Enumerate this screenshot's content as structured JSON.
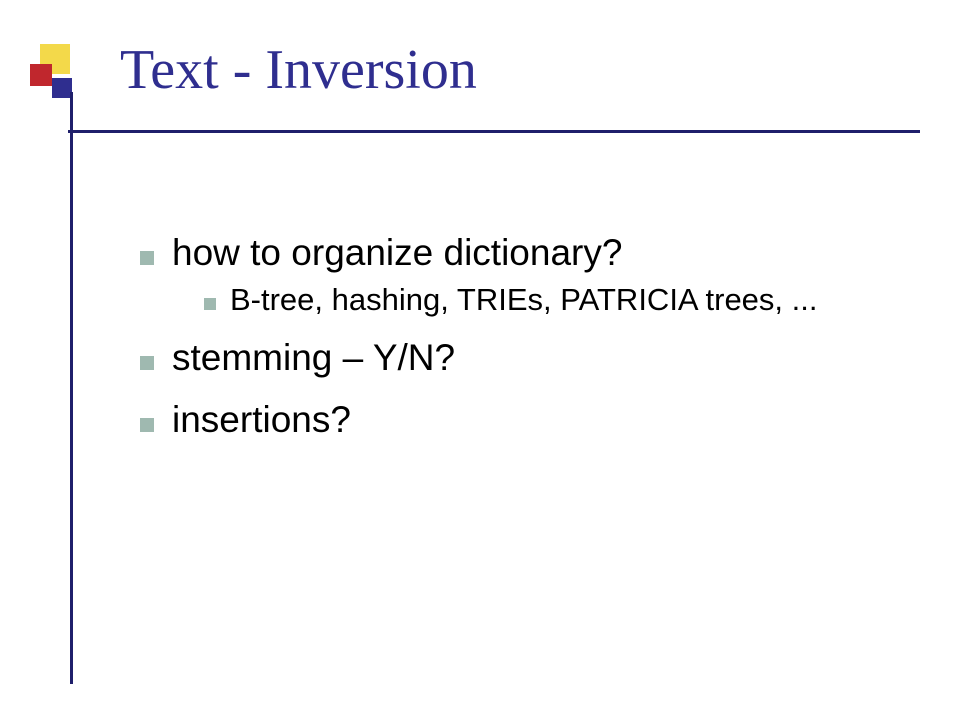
{
  "title": "Text - Inversion",
  "bullets": [
    {
      "text": "how to organize dictionary?",
      "children": [
        {
          "text": "B-tree, hashing, TRIEs, PATRICIA trees, ..."
        }
      ]
    },
    {
      "text": "stemming – Y/N?"
    },
    {
      "text": "insertions?"
    }
  ],
  "colors": {
    "title": "#2f2e8f",
    "rule": "#1f1f6b",
    "bullet": "#9fb9b0",
    "accentYellow": "#f3d94a",
    "accentRed": "#c0272d",
    "accentBlue": "#2f2e8f"
  }
}
